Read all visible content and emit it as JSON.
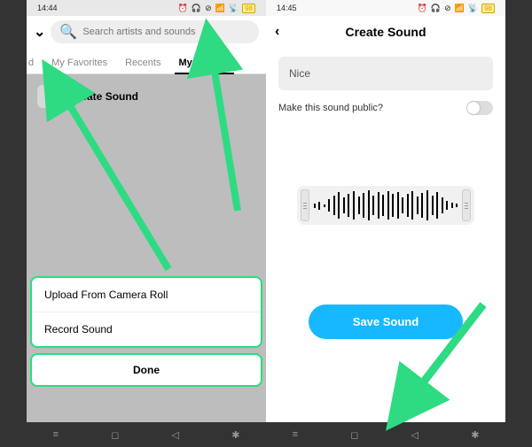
{
  "left": {
    "status": {
      "time": "14:44",
      "battery": "98"
    },
    "search_placeholder": "Search artists and sounds",
    "tabs": {
      "cut": "d",
      "fav": "My Favorites",
      "recents": "Recents",
      "mysounds": "My Sounds"
    },
    "create_label": "Create Sound",
    "sheet": {
      "upload": "Upload From Camera Roll",
      "record": "Record Sound",
      "done": "Done"
    }
  },
  "right": {
    "status": {
      "time": "14:45",
      "battery": "98"
    },
    "title": "Create Sound",
    "sound_name": "Nice",
    "public_label": "Make this sound public?",
    "save_label": "Save Sound"
  },
  "colors": {
    "arrow": "#2edb82",
    "accent": "#17b8ff"
  }
}
